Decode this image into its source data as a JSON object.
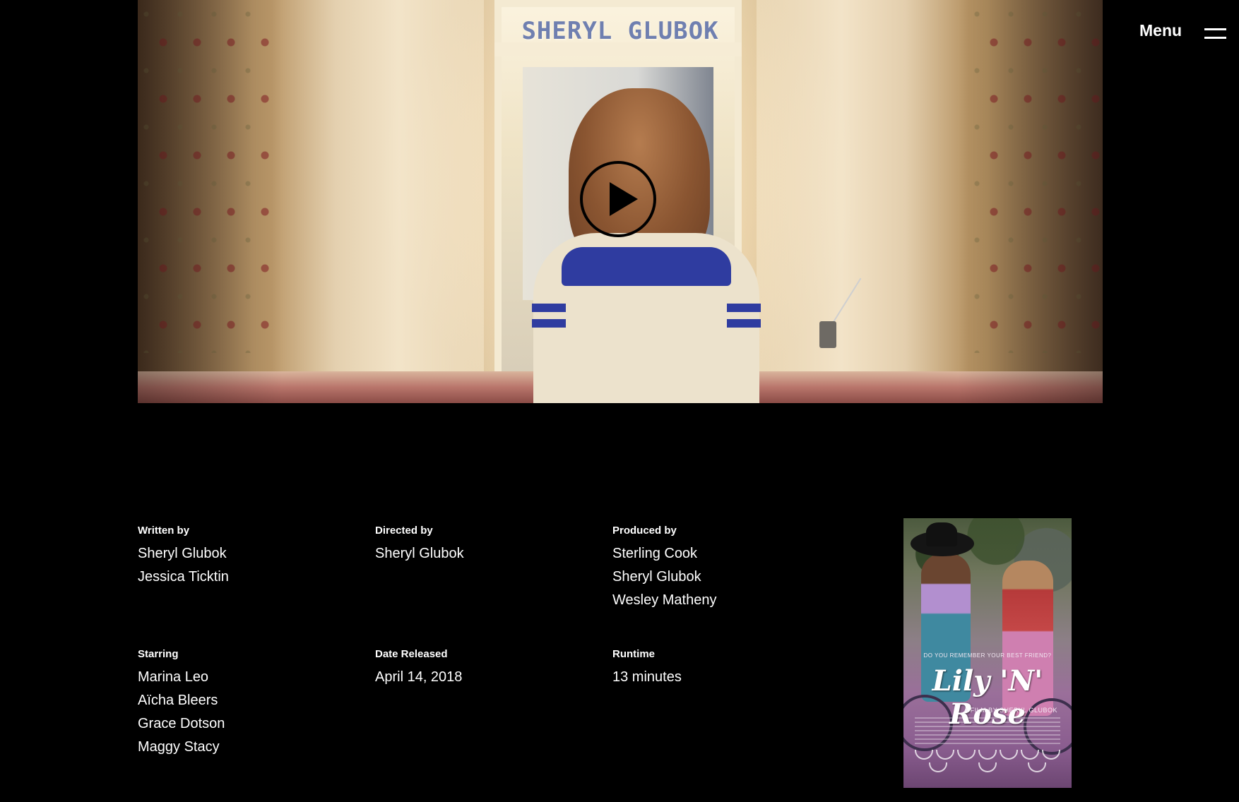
{
  "brand": {
    "logo_text": "SHERYL GLUBOK"
  },
  "nav": {
    "menu_label": "Menu",
    "menu_icon": "hamburger-menu-icon"
  },
  "hero": {
    "play_icon": "play-icon"
  },
  "credits": {
    "written": {
      "label": "Written by",
      "names": [
        "Sheryl Glubok",
        "Jessica Ticktin"
      ]
    },
    "directed": {
      "label": "Directed by",
      "names": [
        "Sheryl Glubok"
      ]
    },
    "produced": {
      "label": "Produced by",
      "names": [
        "Sterling Cook",
        "Sheryl Glubok",
        "Wesley Matheny"
      ]
    },
    "starring": {
      "label": "Starring",
      "names": [
        "Marina Leo",
        "Aïcha Bleers",
        "Grace Dotson",
        "Maggy Stacy"
      ]
    },
    "date": {
      "label": "Date Released",
      "names": [
        "April 14, 2018"
      ]
    },
    "runtime": {
      "label": "Runtime",
      "names": [
        "13 minutes"
      ]
    }
  },
  "poster": {
    "tagline": "DO YOU REMEMBER YOUR BEST FRIEND?",
    "title": "Lily 'N' Rose",
    "byline": "A FILM BY SHERYL GLUBOK"
  },
  "colors": {
    "background": "#000000",
    "text": "#ffffff",
    "logo": "#6f7fb0"
  }
}
